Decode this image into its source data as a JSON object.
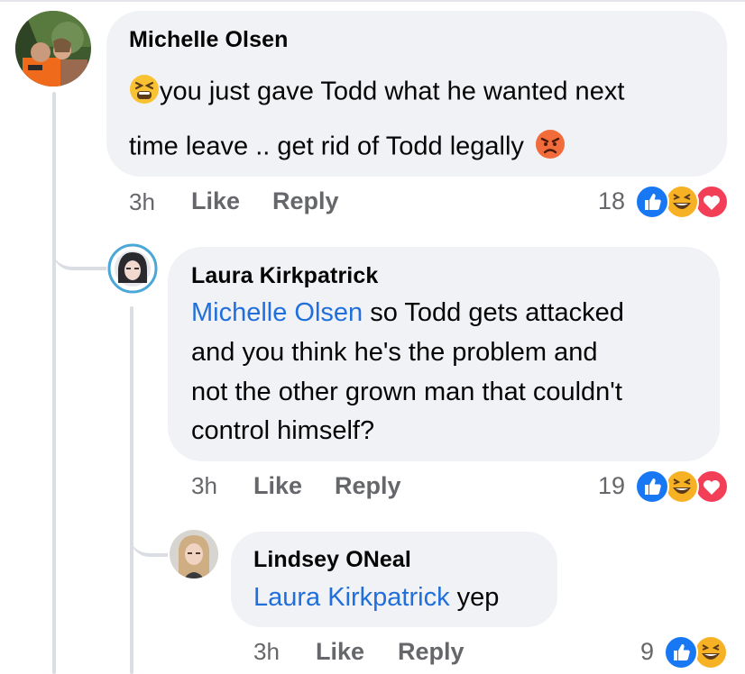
{
  "comments": [
    {
      "author": "Michelle Olsen",
      "lines": [
        "you just gave Todd what he wanted next",
        "time leave .. get rid of Todd legally"
      ],
      "time": "3h",
      "like_label": "Like",
      "reply_label": "Reply",
      "reaction_count": "18",
      "reactions": [
        "like",
        "haha",
        "love"
      ],
      "emojis": [
        "tired-face-emoji",
        "angry-face-emoji"
      ]
    },
    {
      "author": "Laura Kirkpatrick",
      "mention": "Michelle Olsen",
      "lines": [
        " so Todd gets attacked",
        "and you think he's the problem and",
        "not the other grown man that couldn't",
        "control himself?"
      ],
      "time": "3h",
      "like_label": "Like",
      "reply_label": "Reply",
      "reaction_count": "19",
      "reactions": [
        "like",
        "haha",
        "love"
      ]
    },
    {
      "author": "Lindsey ONeal",
      "mention": "Laura Kirkpatrick",
      "lines": [
        " yep"
      ],
      "time": "3h",
      "like_label": "Like",
      "reply_label": "Reply",
      "reaction_count": "9",
      "reactions": [
        "like",
        "haha"
      ]
    }
  ],
  "colors": {
    "bubble": "#f0f2f5",
    "mention": "#216fdb",
    "meta": "#65676b",
    "like": "#1877f2",
    "love": "#f33e58",
    "haha": "#f7b125"
  }
}
